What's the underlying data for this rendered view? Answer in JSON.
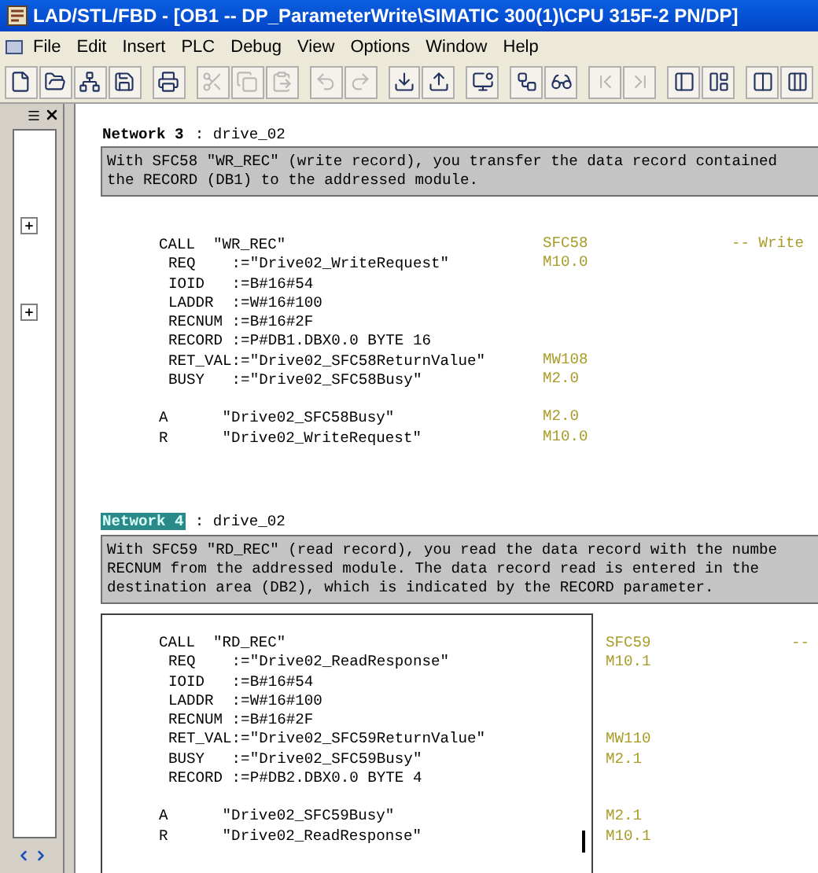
{
  "window": {
    "title": "LAD/STL/FBD  - [OB1 -- DP_ParameterWrite\\SIMATIC 300(1)\\CPU 315F-2 PN/DP]"
  },
  "menu": [
    "File",
    "Edit",
    "Insert",
    "PLC",
    "Debug",
    "View",
    "Options",
    "Window",
    "Help"
  ],
  "toolbar": [
    {
      "kind": "new",
      "disabled": false
    },
    {
      "kind": "open",
      "disabled": false
    },
    {
      "kind": "network",
      "disabled": false
    },
    {
      "kind": "save",
      "disabled": false
    },
    {
      "kind": "print",
      "disabled": false
    },
    {
      "kind": "cut",
      "disabled": true
    },
    {
      "kind": "copy",
      "disabled": true
    },
    {
      "kind": "paste",
      "disabled": true
    },
    {
      "kind": "undo",
      "disabled": true
    },
    {
      "kind": "redo",
      "disabled": true
    },
    {
      "kind": "download",
      "disabled": false
    },
    {
      "kind": "upload",
      "disabled": false
    },
    {
      "kind": "monitor",
      "disabled": false
    },
    {
      "kind": "nodes",
      "disabled": false
    },
    {
      "kind": "glasses",
      "disabled": false
    },
    {
      "kind": "first",
      "disabled": true
    },
    {
      "kind": "last",
      "disabled": true
    },
    {
      "kind": "panel",
      "disabled": false
    },
    {
      "kind": "overview",
      "disabled": false
    },
    {
      "kind": "contact",
      "disabled": false
    },
    {
      "kind": "coil",
      "disabled": false
    }
  ],
  "networks": [
    {
      "label": "Network 3",
      "title": ": drive_02",
      "selected": false,
      "comment": [
        "With SFC58 \"WR_REC\" (write record), you transfer the data record contained",
        "the RECORD (DB1) to the addressed module."
      ],
      "blocks": [
        [
          {
            "kind": "call",
            "statement": "CALL  \"WR_REC\"",
            "address": "SFC58",
            "note": "-- Write"
          },
          {
            "kind": "param",
            "statement": "REQ    :=\"Drive02_WriteRequest\"",
            "address": "M10.0"
          },
          {
            "kind": "param",
            "statement": "IOID   :=B#16#54"
          },
          {
            "kind": "param",
            "statement": "LADDR  :=W#16#100"
          },
          {
            "kind": "param",
            "statement": "RECNUM :=B#16#2F"
          },
          {
            "kind": "param",
            "statement": "RECORD :=P#DB1.DBX0.0 BYTE 16"
          },
          {
            "kind": "param",
            "statement": "RET_VAL:=\"Drive02_SFC58ReturnValue\"",
            "address": "MW108"
          },
          {
            "kind": "param",
            "statement": "BUSY   :=\"Drive02_SFC58Busy\"",
            "address": "M2.0"
          }
        ],
        [
          {
            "kind": "instr",
            "statement": "A      \"Drive02_SFC58Busy\"",
            "address": "M2.0"
          },
          {
            "kind": "instr",
            "statement": "R      \"Drive02_WriteRequest\"",
            "address": "M10.0"
          }
        ]
      ]
    },
    {
      "label": "Network 4",
      "title": ": drive_02",
      "selected": true,
      "comment": [
        "With SFC59 \"RD_REC\" (read record), you read the data record with the numbe",
        "RECNUM from the addressed module. The data record read is entered in the",
        "destination area (DB2), which is indicated by the RECORD parameter."
      ],
      "blocks": [
        [
          {
            "kind": "call",
            "statement": "CALL  \"RD_REC\"",
            "address": "SFC59",
            "note": "--"
          },
          {
            "kind": "param",
            "statement": "REQ    :=\"Drive02_ReadResponse\"",
            "address": "M10.1"
          },
          {
            "kind": "param",
            "statement": "IOID   :=B#16#54"
          },
          {
            "kind": "param",
            "statement": "LADDR  :=W#16#100"
          },
          {
            "kind": "param",
            "statement": "RECNUM :=B#16#2F"
          },
          {
            "kind": "param",
            "statement": "RET_VAL:=\"Drive02_SFC59ReturnValue\"",
            "address": "MW110"
          },
          {
            "kind": "param",
            "statement": "BUSY   :=\"Drive02_SFC59Busy\"",
            "address": "M2.1"
          },
          {
            "kind": "param",
            "statement": "RECORD :=P#DB2.DBX0.0 BYTE 4"
          }
        ],
        [
          {
            "kind": "instr",
            "statement": "A      \"Drive02_SFC59Busy\"",
            "address": "M2.1"
          },
          {
            "kind": "instr",
            "statement": "R      \"Drive02_ReadResponse\"",
            "address": "M10.1"
          }
        ]
      ]
    }
  ]
}
